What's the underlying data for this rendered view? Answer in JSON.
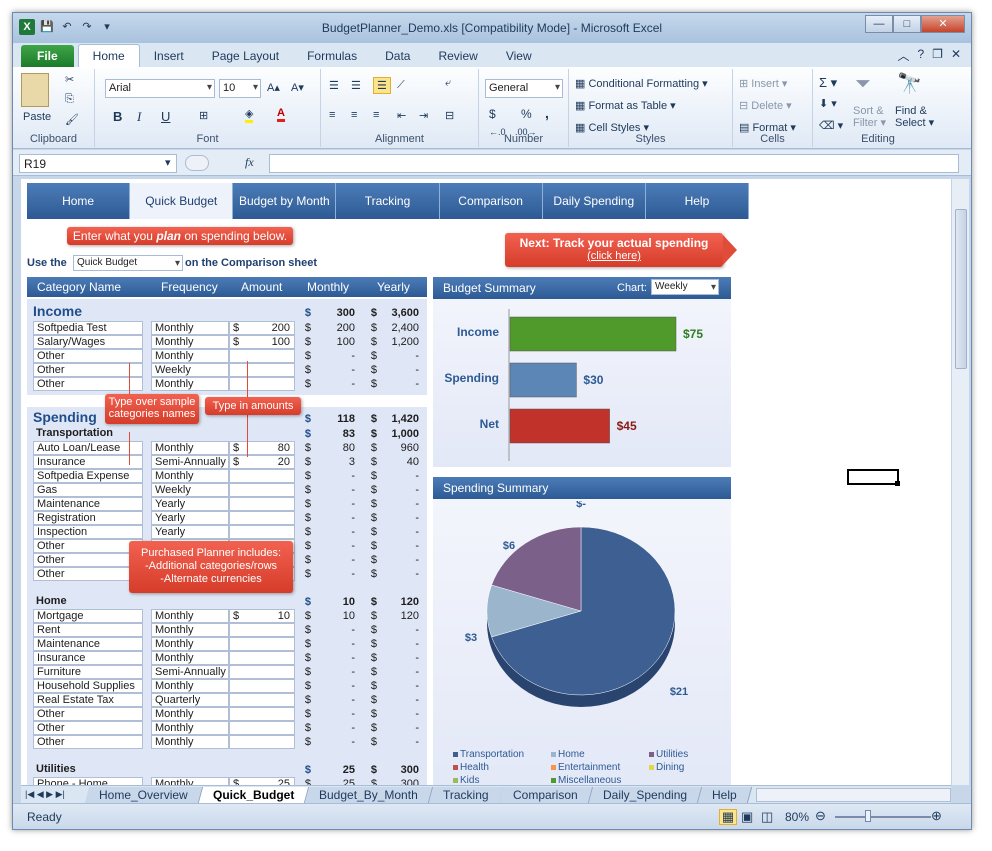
{
  "window": {
    "title": "BudgetPlanner_Demo.xls  [Compatibility Mode]  -  Microsoft Excel"
  },
  "ribbon_tabs": [
    "File",
    "Home",
    "Insert",
    "Page Layout",
    "Formulas",
    "Data",
    "Review",
    "View"
  ],
  "ribbon": {
    "clipboard": {
      "label": "Clipboard",
      "paste": "Paste"
    },
    "font": {
      "label": "Font",
      "name": "Arial",
      "size": "10"
    },
    "alignment": {
      "label": "Alignment"
    },
    "number": {
      "label": "Number",
      "format": "General",
      "dollar": "$",
      "percent": "%",
      "comma": ","
    },
    "styles": {
      "label": "Styles",
      "conditional": "Conditional Formatting",
      "table": "Format as Table",
      "cell": "Cell Styles"
    },
    "cells": {
      "label": "Cells",
      "insert": "Insert",
      "delete": "Delete",
      "format": "Format"
    },
    "editing": {
      "label": "Editing",
      "sort": "Sort &",
      "filter": "Filter",
      "find": "Find &",
      "select": "Select"
    }
  },
  "formula_bar": {
    "name_box": "R19",
    "fx": "fx"
  },
  "nav": [
    "Home",
    "Quick Budget",
    "Budget by Month",
    "Tracking",
    "Comparison",
    "Daily Spending",
    "Help"
  ],
  "callouts": {
    "plan_pre": "Enter what you ",
    "plan_em": "plan",
    "plan_post": " on spending below.",
    "next_title": "Next: Track your actual spending",
    "next_link": "(click here)",
    "type_cats": "Type over sample categories names",
    "type_amounts": "Type in amounts",
    "purchased_1": "Purchased Planner includes:",
    "purchased_2": "-Additional categories/rows",
    "purchased_3": "-Alternate currencies"
  },
  "use_the": {
    "pre": "Use the",
    "value": "Quick Budget",
    "post": "on the Comparison sheet"
  },
  "headers": {
    "category": "Category Name",
    "frequency": "Frequency",
    "amount": "Amount",
    "monthly": "Monthly",
    "yearly": "Yearly"
  },
  "income": {
    "title": "Income",
    "monthly": "300",
    "yearly": "3,600",
    "rows": [
      {
        "name": "Softpedia Test",
        "freq": "Monthly",
        "amt": "200",
        "m": "200",
        "y": "2,400"
      },
      {
        "name": "Salary/Wages",
        "freq": "Monthly",
        "amt": "100",
        "m": "100",
        "y": "1,200"
      },
      {
        "name": "Other",
        "freq": "Monthly",
        "amt": "",
        "m": "-",
        "y": "-"
      },
      {
        "name": "Other",
        "freq": "Weekly",
        "amt": "",
        "m": "-",
        "y": "-"
      },
      {
        "name": "Other",
        "freq": "Monthly",
        "amt": "",
        "m": "-",
        "y": "-"
      }
    ]
  },
  "spending": {
    "title": "Spending",
    "monthly": "118",
    "yearly": "1,420"
  },
  "groups": [
    {
      "title": "Transportation",
      "m": "83",
      "y": "1,000",
      "rows": [
        {
          "name": "Auto Loan/Lease",
          "freq": "Monthly",
          "amt": "80",
          "m": "80",
          "y": "960"
        },
        {
          "name": "Insurance",
          "freq": "Semi-Annually",
          "amt": "20",
          "m": "3",
          "y": "40"
        },
        {
          "name": "Softpedia Expense",
          "freq": "Monthly",
          "amt": "",
          "m": "-",
          "y": "-"
        },
        {
          "name": "Gas",
          "freq": "Weekly",
          "amt": "",
          "m": "-",
          "y": "-"
        },
        {
          "name": "Maintenance",
          "freq": "Yearly",
          "amt": "",
          "m": "-",
          "y": "-"
        },
        {
          "name": "Registration",
          "freq": "Yearly",
          "amt": "",
          "m": "-",
          "y": "-"
        },
        {
          "name": "Inspection",
          "freq": "Yearly",
          "amt": "",
          "m": "-",
          "y": "-"
        },
        {
          "name": "Other",
          "freq": "",
          "amt": "",
          "m": "-",
          "y": "-"
        },
        {
          "name": "Other",
          "freq": "",
          "amt": "",
          "m": "-",
          "y": "-"
        },
        {
          "name": "Other",
          "freq": "",
          "amt": "",
          "m": "-",
          "y": "-"
        }
      ]
    },
    {
      "title": "Home",
      "m": "10",
      "y": "120",
      "rows": [
        {
          "name": "Mortgage",
          "freq": "Monthly",
          "amt": "10",
          "m": "10",
          "y": "120"
        },
        {
          "name": "Rent",
          "freq": "Monthly",
          "amt": "",
          "m": "-",
          "y": "-"
        },
        {
          "name": "Maintenance",
          "freq": "Monthly",
          "amt": "",
          "m": "-",
          "y": "-"
        },
        {
          "name": "Insurance",
          "freq": "Monthly",
          "amt": "",
          "m": "-",
          "y": "-"
        },
        {
          "name": "Furniture",
          "freq": "Semi-Annually",
          "amt": "",
          "m": "-",
          "y": "-"
        },
        {
          "name": "Household Supplies",
          "freq": "Monthly",
          "amt": "",
          "m": "-",
          "y": "-"
        },
        {
          "name": "Real Estate Tax",
          "freq": "Quarterly",
          "amt": "",
          "m": "-",
          "y": "-"
        },
        {
          "name": "Other",
          "freq": "Monthly",
          "amt": "",
          "m": "-",
          "y": "-"
        },
        {
          "name": "Other",
          "freq": "Monthly",
          "amt": "",
          "m": "-",
          "y": "-"
        },
        {
          "name": "Other",
          "freq": "Monthly",
          "amt": "",
          "m": "-",
          "y": "-"
        }
      ]
    },
    {
      "title": "Utilities",
      "m": "25",
      "y": "300",
      "rows": [
        {
          "name": "Phone - Home",
          "freq": "Monthly",
          "amt": "25",
          "m": "25",
          "y": "300"
        }
      ]
    }
  ],
  "dollar": "$",
  "budget_summary": {
    "title": "Budget Summary",
    "chart_label": "Chart:",
    "chart_value": "Weekly"
  },
  "spending_summary": {
    "title": "Spending Summary"
  },
  "chart_data": [
    {
      "type": "bar",
      "title": "Budget Summary",
      "categories": [
        "Income",
        "Spending",
        "Net"
      ],
      "values": [
        75,
        30,
        45
      ],
      "labels": [
        "$75",
        "$30",
        "$45"
      ],
      "colors": [
        "#4f9a2a",
        "#5b86b5",
        "#c0322a"
      ]
    },
    {
      "type": "pie",
      "title": "Spending Summary",
      "categories": [
        "Transportation",
        "Home",
        "Utilities",
        "Health",
        "Entertainment",
        "Dining",
        "Kids",
        "Miscellaneous"
      ],
      "values": [
        21,
        3,
        6,
        0,
        0,
        0,
        0,
        0
      ],
      "labels": [
        "$21",
        "$3",
        "$6",
        "$-"
      ],
      "colors": [
        "#3d5f92",
        "#9bb6cc",
        "#7b6189",
        "#c0504d",
        "#f79646",
        "#e8d448",
        "#9bbb59",
        "#4f9a2a"
      ]
    }
  ],
  "sheet_tabs": [
    "Home_Overview",
    "Quick_Budget",
    "Budget_By_Month",
    "Tracking",
    "Comparison",
    "Daily_Spending",
    "Help"
  ],
  "status": {
    "ready": "Ready",
    "zoom": "80%"
  }
}
